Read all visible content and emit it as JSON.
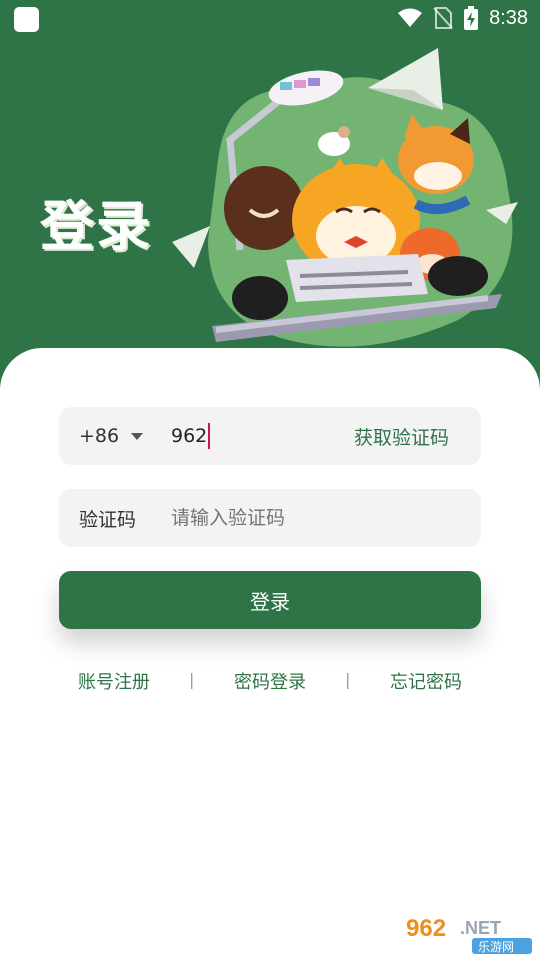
{
  "status_bar": {
    "time": "8:38",
    "icons": [
      "wifi-icon",
      "no-sim-icon",
      "battery-charging-icon"
    ]
  },
  "hero": {
    "title": "登录",
    "illustration": "cats-on-laptop-illustration"
  },
  "login_form": {
    "country_code": "+86",
    "phone_value": "962",
    "get_code_label": "获取验证码",
    "code_label": "验证码",
    "code_placeholder": "请输入验证码",
    "submit_label": "登录"
  },
  "links": {
    "register": "账号注册",
    "separator": "|",
    "password_login": "密码登录",
    "forgot_password": "忘记密码"
  },
  "watermark": {
    "brand": "962.NET",
    "subtitle": "乐游网"
  },
  "colors": {
    "primary": "#2e7447",
    "field_bg": "#f3f3f3",
    "cursor": "#c2185b"
  }
}
